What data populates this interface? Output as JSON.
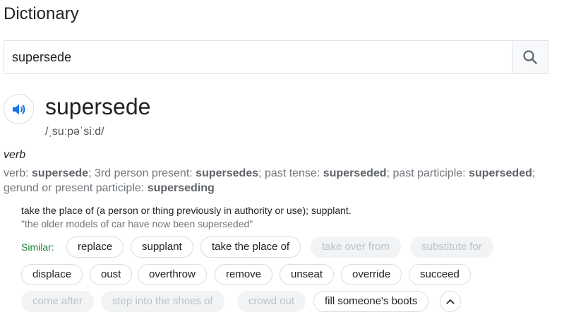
{
  "header": {
    "title": "Dictionary"
  },
  "search": {
    "value": "supersede"
  },
  "entry": {
    "word": "supersede",
    "phonetic": "/ˌsuːpəˈsiːd/",
    "part_of_speech": "verb",
    "forms": {
      "lead": "verb:",
      "base": "supersede",
      "third_label": "3rd person present:",
      "third": "supersedes",
      "past_label": "past tense:",
      "past": "superseded",
      "participle_label": "past participle:",
      "participle": "superseded",
      "gerund_label": "gerund or present participle:",
      "gerund": "superseding"
    },
    "definition": "take the place of (a person or thing previously in authority or use); supplant.",
    "example": "\"the older models of car have now been superseded\"",
    "similar_label": "Similar:",
    "similar": [
      "replace",
      "supplant",
      "take the place of",
      "take over from",
      "substitute for",
      "displace",
      "oust",
      "overthrow",
      "remove",
      "unseat",
      "override",
      "succeed",
      "come after",
      "step into the shoes of",
      "crowd out",
      "fill someone's boots"
    ]
  },
  "icons": {
    "search": "search-icon",
    "speaker": "speaker-icon",
    "collapse": "chevron-up-icon"
  },
  "colors": {
    "accent": "#1a73e8",
    "similar_label": "#188038",
    "muted_chip_text": "#bdc1c6"
  }
}
